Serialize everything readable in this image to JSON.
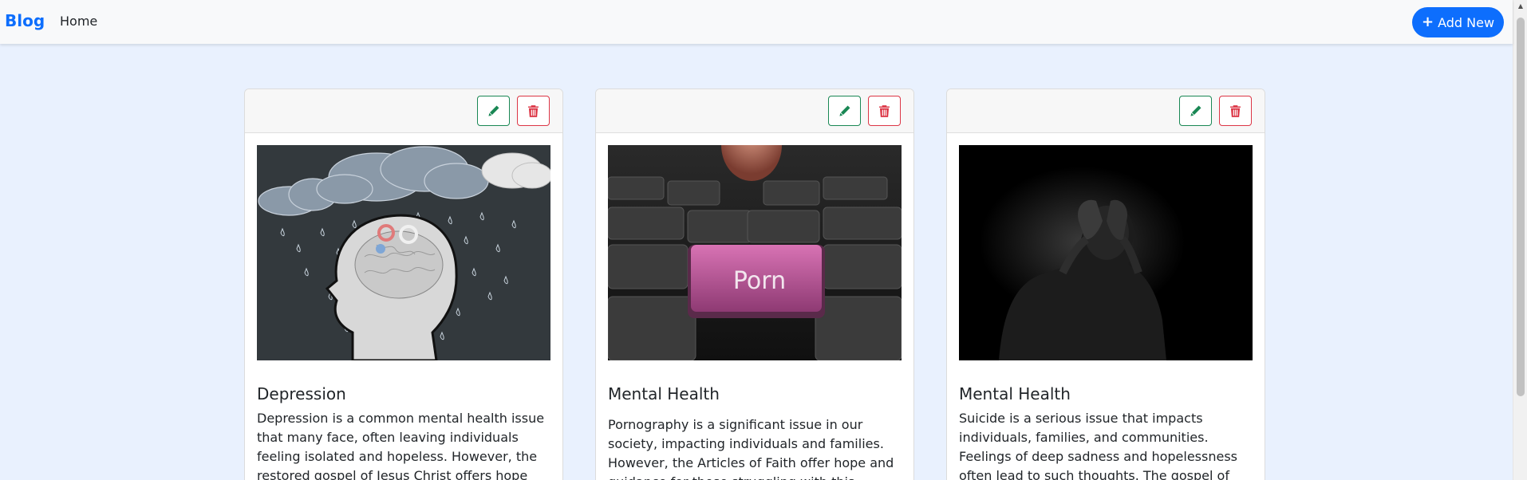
{
  "navbar": {
    "brand": "Blog",
    "home_label": "Home",
    "add_button_label": "Add New"
  },
  "colors": {
    "primary": "#0d6efd",
    "edit": "#198754",
    "delete": "#dc3545",
    "page_bg": "#e9f1fe"
  },
  "icons": {
    "add": "plus-icon",
    "edit": "pencil-icon",
    "delete": "trash-icon"
  },
  "cards": [
    {
      "image": "depression-illustration",
      "title": "Depression",
      "text": "Depression is a common mental health issue that many face, often leaving individuals feeling isolated and hopeless. However, the restored gospel of Jesus Christ offers hope"
    },
    {
      "image": "keyboard-key-photo",
      "image_label": "Porn",
      "title": "Mental Health",
      "text": "Pornography is a significant issue in our society, impacting individuals and families. However, the Articles of Faith offer hope and guidance for those struggling with this"
    },
    {
      "image": "distressed-man-photo",
      "title": "Mental Health",
      "text": "Suicide is a serious issue that impacts individuals, families, and communities. Feelings of deep sadness and hopelessness often lead to such thoughts. The gospel of"
    }
  ]
}
